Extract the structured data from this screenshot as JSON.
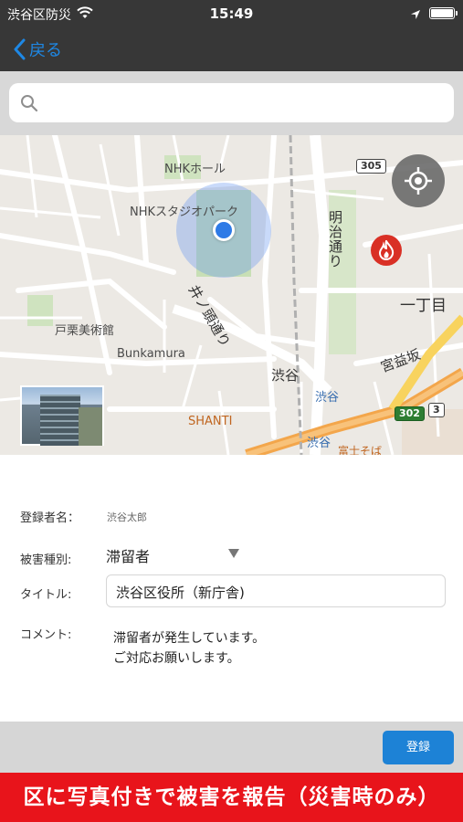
{
  "status_bar": {
    "carrier": "渋谷区防災",
    "time": "15:49"
  },
  "nav": {
    "back_label": "戻る"
  },
  "search": {
    "value": "",
    "placeholder": ""
  },
  "map": {
    "labels": {
      "nhk_hall": "NHKホール",
      "nhk_studio_park": "NHKスタジオパーク",
      "togakushi_museum": "戸栗美術館",
      "bunkamura": "Bunkamura",
      "shibuya_top": "渋谷",
      "shibuya_station_1": "渋谷",
      "shibuya_station_2": "渋谷",
      "shanti": "SHANTI",
      "meiji_dori": "明治通り",
      "inokashira_dori": "井ノ頭通り",
      "itchome": "一丁目",
      "miyamasuzaka": "宮益坂",
      "fuji_soba": "富士そば"
    },
    "route_shields": {
      "r305": "305",
      "r302": "302",
      "r3": "3"
    }
  },
  "form": {
    "registrant_label": "登録者名：",
    "registrant_value": "渋谷太郎",
    "damage_type_label": "被害種別:",
    "damage_type_value": "滞留者",
    "title_label": "タイトル:",
    "title_value": "渋谷区役所（新庁舎)",
    "comment_label": "コメント:",
    "comment_lines": [
      "滞留者が発生しています。",
      "ご対応お願いします。"
    ]
  },
  "submit_label": "登録",
  "banner_text": "区に写真付きで被害を報告（災害時のみ）",
  "colors": {
    "bar_dark": "#373737",
    "accent_blue": "#1d82d6",
    "banner_red": "#e8141b",
    "fire_red": "#d93025",
    "location_blue": "#2e7ae6"
  }
}
